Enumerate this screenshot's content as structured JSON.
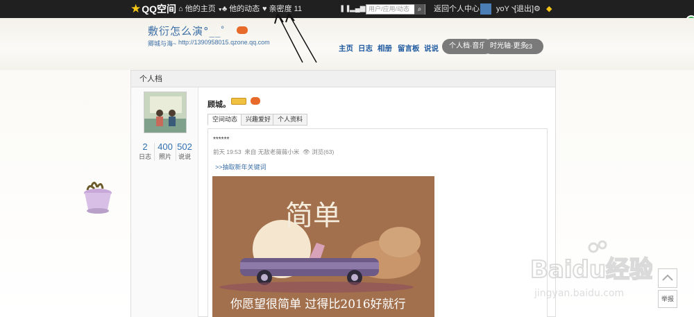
{
  "topbar": {
    "logo": "QQ空间",
    "home": "他的主页",
    "feeds": "他的动态",
    "intimacy_label": "亲密度",
    "intimacy_value": "11",
    "search_placeholder": "用户/应用/动态",
    "back_home": "返回个人中心",
    "user": "yoY丶",
    "logout": "[退出]"
  },
  "header": {
    "space_name": "敷衍怎么演°__゜",
    "space_desc": "卿城与海~",
    "space_url": "http://1390958015.qzone.qq.com",
    "nav": [
      "主页",
      "日志",
      "相册",
      "留言板",
      "说说"
    ],
    "pill1": "个人档·音乐",
    "pill2": "时光轴·更多",
    "pill2_badge": "23"
  },
  "panel": {
    "title": "个人档",
    "stats": [
      {
        "num": "2",
        "label": "日志"
      },
      {
        "num": "400",
        "label": "照片"
      },
      {
        "num": "502",
        "label": "说说"
      }
    ],
    "username": "顾城。",
    "tabs": [
      "空间动态",
      "兴趣爱好",
      "个人资料"
    ]
  },
  "feed": {
    "content": "******",
    "time": "前天 19:53",
    "source": "来自 无敌老薇薇小米",
    "views": "浏览(63)",
    "keyword": ">>抽取新年关键词",
    "image_title": "简单",
    "image_caption": "你愿望很简单 过得比2016好就行"
  },
  "widgets": {
    "report": "举报",
    "watermark_brand": "Baidu经验",
    "watermark_url": "jingyan.baidu.com"
  },
  "colors": {
    "topbar": "#202020",
    "link": "#3c6fa6",
    "nav": "#1f5aa0"
  }
}
